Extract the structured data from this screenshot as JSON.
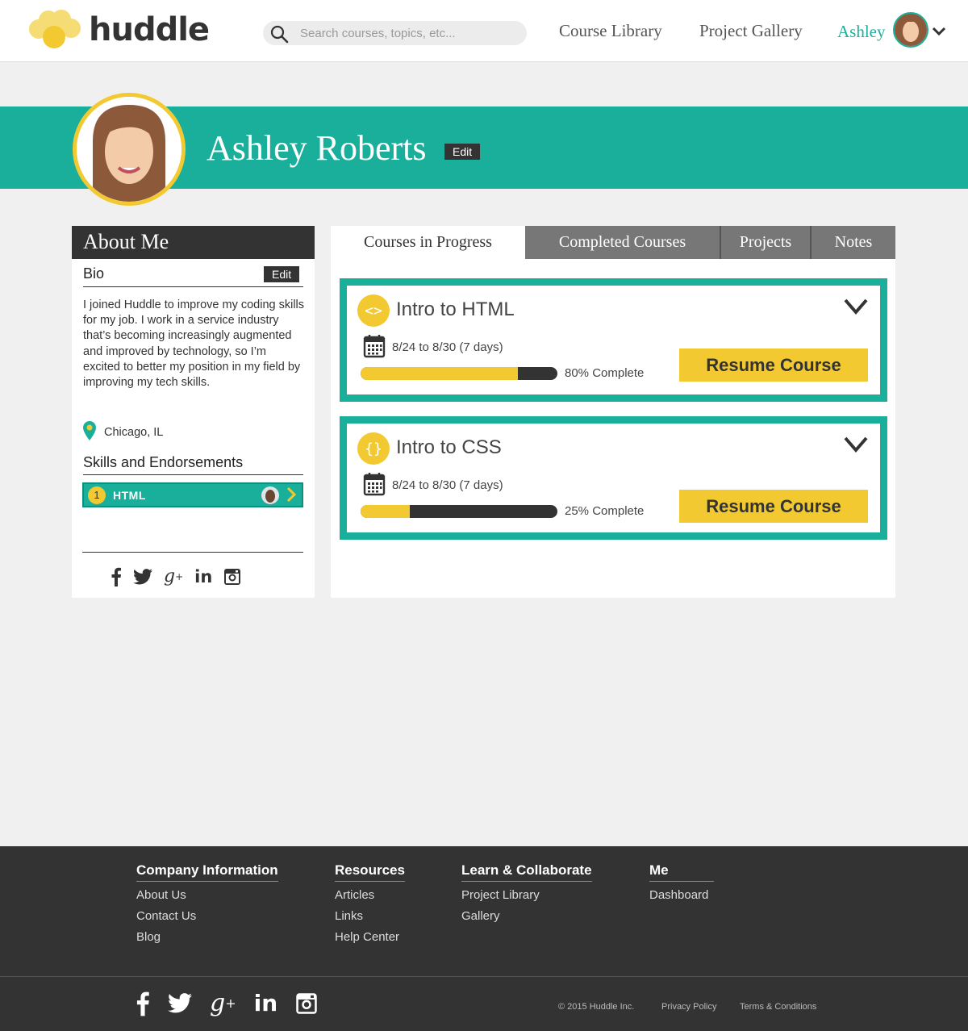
{
  "brand": {
    "name": "huddle",
    "color": "#f2c930"
  },
  "colors": {
    "accent": "#1aaf9b",
    "yellow": "#f2c930",
    "dark": "#333333"
  },
  "header": {
    "search_placeholder": "Search courses, topics, etc...",
    "nav": [
      "Course Library",
      "Project Gallery"
    ],
    "user": "Ashley"
  },
  "profile": {
    "name": "Ashley Roberts",
    "edit_label": "Edit"
  },
  "about": {
    "title": "About Me",
    "bio_label": "Bio",
    "bio_edit": "Edit",
    "bio": "I joined Huddle to improve my coding skills for my job. I work in a service industry that’s becoming increasingly augmented and improved  by technology, so I’m excited to better my position in my field by improving my tech skills.",
    "location": "Chicago, IL",
    "skills_title": "Skills and Endorsements",
    "skills": [
      {
        "count": "1",
        "name": "HTML"
      }
    ],
    "social": [
      "facebook-icon",
      "twitter-icon",
      "google-plus-icon",
      "linkedin-icon",
      "instagram-icon"
    ]
  },
  "tabs": [
    "Courses in Progress",
    "Completed Courses",
    "Projects",
    "Notes"
  ],
  "courses": [
    {
      "icon": "<>",
      "title": "Intro to HTML",
      "dates": "8/24 to 8/30 (7 days)",
      "progress": 0.8,
      "progress_label": "80% Complete",
      "action": "Resume Course"
    },
    {
      "icon": "{}",
      "title": "Intro to CSS",
      "dates": "8/24 to 8/30 (7 days)",
      "progress": 0.25,
      "progress_label": "25% Complete",
      "action": "Resume Course"
    }
  ],
  "footer": {
    "columns": [
      {
        "title": "Company Information",
        "links": [
          "About Us",
          "Contact Us",
          "Blog"
        ]
      },
      {
        "title": "Resources",
        "links": [
          "Articles",
          "Links",
          "Help Center"
        ]
      },
      {
        "title": "Learn & Collaborate",
        "links": [
          "Project Library",
          "Gallery"
        ]
      },
      {
        "title": "Me",
        "links": [
          "Dashboard"
        ]
      }
    ],
    "copyright": "© 2015 Huddle Inc.",
    "privacy": "Privacy Policy",
    "terms": "Terms & Conditions"
  }
}
